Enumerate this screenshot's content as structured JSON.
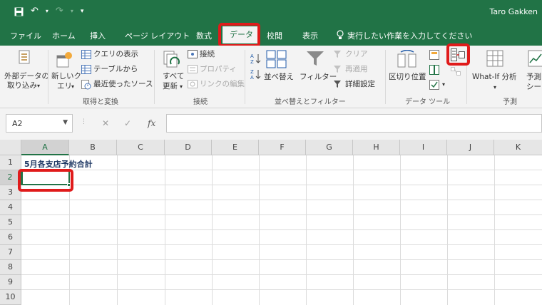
{
  "window": {
    "user_name": "Taro Gakken"
  },
  "qat": {
    "save_icon": "save-icon",
    "undo_icon": "undo-icon",
    "redo_icon": "redo-icon",
    "customize_icon": "customize-qat-icon"
  },
  "tabs": [
    {
      "label": "ファイル"
    },
    {
      "label": "ホーム"
    },
    {
      "label": "挿入"
    },
    {
      "label": "ページ レイアウト"
    },
    {
      "label": "数式"
    },
    {
      "label": "データ",
      "active": true
    },
    {
      "label": "校閲"
    },
    {
      "label": "表示"
    },
    {
      "label": "実行したい作業を入力してください"
    }
  ],
  "ribbon": {
    "external_data": {
      "line1": "外部データの",
      "line2": "取り込み"
    },
    "new_query": {
      "line1": "新しいク",
      "line2": "エリ"
    },
    "show_queries": "クエリの表示",
    "from_table": "テーブルから",
    "recent_sources": "最近使ったソース",
    "group_get_transform": "取得と変換",
    "refresh_all": {
      "line1": "すべて",
      "line2": "更新"
    },
    "connections": "接続",
    "properties": "プロパティ",
    "edit_links": "リンクの編集",
    "group_connections": "接続",
    "sort": "並べ替え",
    "filter": "フィルター",
    "clear": "クリア",
    "reapply": "再適用",
    "advanced": "詳細設定",
    "group_sort_filter": "並べ替えとフィルター",
    "text_to_columns": "区切り位置",
    "group_data_tools": "データ ツール",
    "whatif": "What-If 分析",
    "forecast": {
      "line1": "予測",
      "line2": "シー"
    },
    "group_forecast": "予測",
    "colors": {
      "accent": "#217346",
      "highlight": "#e01b1b"
    }
  },
  "formula_bar": {
    "name_box": "A2",
    "cancel": "✕",
    "enter": "✓",
    "fx": "fx",
    "formula": ""
  },
  "sheet": {
    "columns": [
      "A",
      "B",
      "C",
      "D",
      "E",
      "F",
      "G",
      "H",
      "I",
      "J",
      "K"
    ],
    "rows": [
      "1",
      "2",
      "3",
      "4",
      "5",
      "6",
      "7",
      "8",
      "9",
      "10"
    ],
    "selected_column": "A",
    "selected_row": "2",
    "a1": "5月各支店予約合計",
    "active_cell": "A2"
  }
}
